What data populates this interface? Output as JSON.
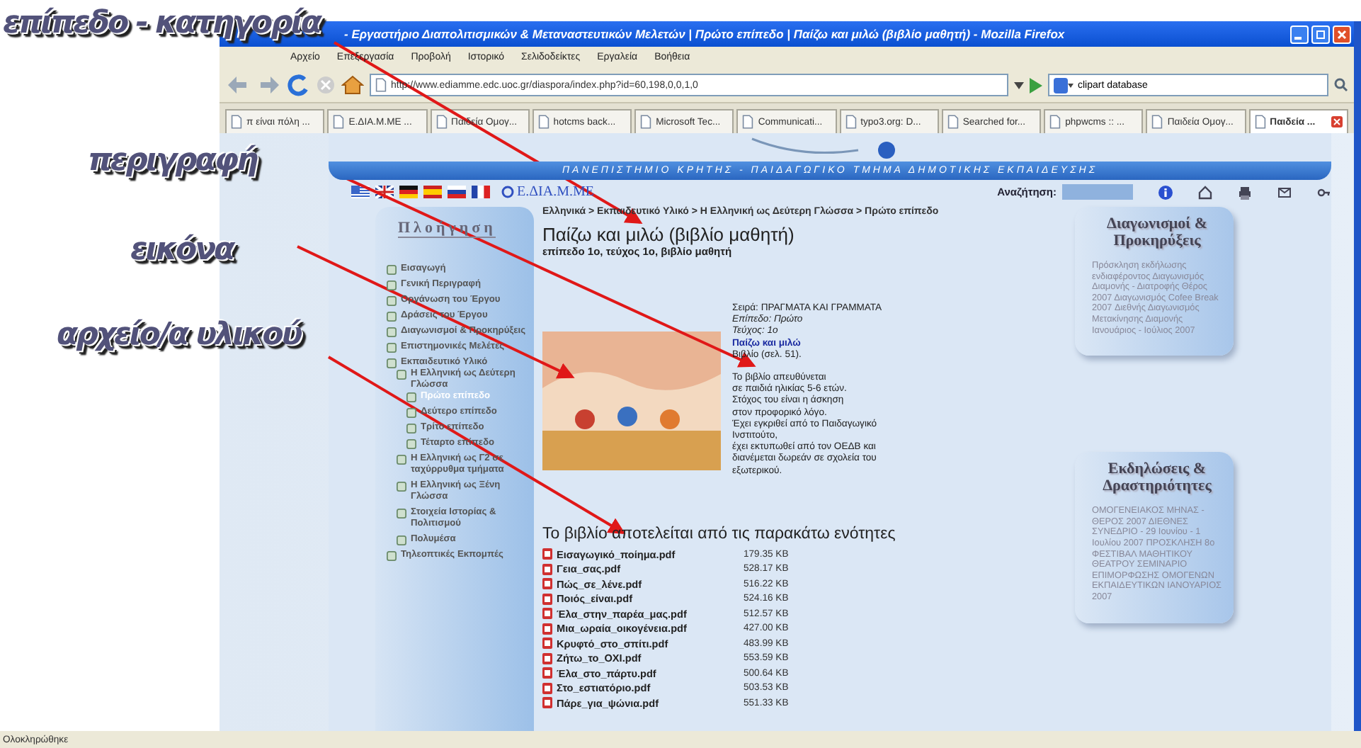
{
  "annotations": [
    {
      "label": "επίπεδο - κατηγορία"
    },
    {
      "label": "περιγραφή"
    },
    {
      "label": "εικόνα"
    },
    {
      "label": "αρχείο/α υλικού"
    }
  ],
  "window": {
    "title": "- Εργαστήριο Διαπολιτισμικών & Μεταναστευτικών Μελετών | Πρώτο επίπεδο | Παίζω και μιλώ (βιβλίο μαθητή) - Mozilla Firefox"
  },
  "menu": [
    "Αρχείο",
    "Επεξεργασία",
    "Προβολή",
    "Ιστορικό",
    "Σελιδοδείκτες",
    "Εργαλεία",
    "Βοήθεια"
  ],
  "toolbar": {
    "url": "http://www.ediamme.edc.uoc.gr/diaspora/index.php?id=60,198,0,0,1,0",
    "search": "clipart database"
  },
  "tabs": [
    {
      "label": "π είναι πόλη ...",
      "selected": false
    },
    {
      "label": "E.ΔΙΑ.Μ.ΜΕ ...",
      "selected": false
    },
    {
      "label": "Παιδεία Ομογ...",
      "selected": false
    },
    {
      "label": "hotcms back...",
      "selected": false
    },
    {
      "label": "Microsoft Tec...",
      "selected": false
    },
    {
      "label": "Communicati...",
      "selected": false
    },
    {
      "label": "typo3.org: D...",
      "selected": false
    },
    {
      "label": "Searched for...",
      "selected": false
    },
    {
      "label": "phpwcms :: ...",
      "selected": false
    },
    {
      "label": "Παιδεία Ομογ...",
      "selected": false
    },
    {
      "label": "Παιδεία ...",
      "selected": true
    }
  ],
  "page": {
    "banner": "ΠΑΝΕΠΙΣΤΗΜΙΟ ΚΡΗΤΗΣ - ΠΑΙΔΑΓΩΓΙΚΟ ΤΜΗΜΑ ΔΗΜΟΤΙΚΗΣ ΕΚΠΑΙΔΕΥΣΗΣ",
    "logo": "E.ΔΙΑ.Μ.ΜΕ",
    "search_label": "Αναζήτηση:",
    "nav": {
      "title": "Πλοήγηση",
      "items": [
        {
          "label": "Εισαγωγή",
          "selected": false
        },
        {
          "label": "Γενική Περιγραφή",
          "selected": false
        },
        {
          "label": "Οργάνωση του Έργου",
          "selected": false
        },
        {
          "label": "Δράσεις του Έργου",
          "selected": false
        },
        {
          "label": "Διαγωνισμοί & Προκηρύξεις",
          "selected": false
        },
        {
          "label": "Επιστημονικές Μελέτες",
          "selected": false
        },
        {
          "label": "Εκπαιδευτικό Υλικό",
          "selected": false,
          "children": [
            {
              "label": "Η Ελληνική ως Δεύτερη Γλώσσα",
              "selected": false,
              "children": [
                {
                  "label": "Πρώτο επίπεδο",
                  "selected": true
                },
                {
                  "label": "Δεύτερο επίπεδο",
                  "selected": false
                },
                {
                  "label": "Τρίτο επίπεδο",
                  "selected": false
                },
                {
                  "label": "Τέταρτο επίπεδο",
                  "selected": false
                }
              ]
            },
            {
              "label": "Η Ελληνική ως Γ2 σε ταχύρρυθμα τμήματα",
              "selected": false
            },
            {
              "label": "Η Ελληνική ως Ξένη Γλώσσα",
              "selected": false
            },
            {
              "label": "Στοιχεία Ιστορίας & Πολιτισμού",
              "selected": false
            },
            {
              "label": "Πολυμέσα",
              "selected": false
            }
          ]
        },
        {
          "label": "Τηλεοπτικές Εκπομπές",
          "selected": false
        }
      ]
    },
    "breadcrumb": "Ελληνικά > Εκπαιδευτικό Υλικό > Η Ελληνική ως Δεύτερη Γλώσσα > Πρώτο επίπεδο",
    "title": "Παίζω και μιλώ (βιβλίο μαθητή)",
    "subtitle": "επίπεδο 1ο, τεύχος 1ο, βιβλίο μαθητή",
    "details": [
      {
        "kind": "plain",
        "text": "Σειρά: ΠΡΑΓΜΑΤΑ ΚΑΙ ΓΡΑΜΜΑΤΑ"
      },
      {
        "kind": "italic",
        "text": "Επίπεδο: Πρώτο"
      },
      {
        "kind": "italic",
        "text": "Τεύχος: 1ο"
      },
      {
        "kind": "link",
        "text": "Παίζω και μιλώ"
      },
      {
        "kind": "plain",
        "text": "Βιβλίο (σελ. 51)."
      }
    ],
    "description": "Το βιβλίο απευθύνεται\nσε παιδιά ηλικίας 5-6 ετών.\nΣτόχος του είναι η άσκηση\nστον προφορικό λόγο.\nΈχει εγκριθεί από το Παιδαγωγικό\nΙνστιτούτο,\nέχει εκτυπωθεί από τον ΟΕΔΒ και\nδιανέμεται δωρεάν σε σχολεία του\nεξωτερικού.",
    "files_heading": "Το βιβλίο αποτελείται από τις παρακάτω ενότητες",
    "files": [
      {
        "name": "Εισαγωγικό_ποίημα.pdf",
        "size": "179.35 KB"
      },
      {
        "name": "Γεια_σας.pdf",
        "size": "528.17 KB"
      },
      {
        "name": "Πώς_σε_λένε.pdf",
        "size": "516.22 KB"
      },
      {
        "name": "Ποιός_είναι.pdf",
        "size": "524.16 KB"
      },
      {
        "name": "Έλα_στην_παρέα_μας.pdf",
        "size": "512.57 KB"
      },
      {
        "name": "Μια_ωραία_οικογένεια.pdf",
        "size": "427.00 KB"
      },
      {
        "name": "Κρυφτό_στο_σπίτι.pdf",
        "size": "483.99 KB"
      },
      {
        "name": "Ζήτω_το_ΟΧΙ.pdf",
        "size": "553.59 KB"
      },
      {
        "name": "Έλα_στο_πάρτυ.pdf",
        "size": "500.64 KB"
      },
      {
        "name": "Στο_εστιατόριο.pdf",
        "size": "503.53 KB"
      },
      {
        "name": "Πάρε_για_ψώνια.pdf",
        "size": "551.33 KB"
      }
    ],
    "side_boxes": [
      {
        "title": "Διαγωνισμοί & Προκηρύξεις",
        "text": "Πρόσκληση εκδήλωσης ενδιαφέροντος Διαγωνισμός Διαμονής - Διατροφής Θέρος 2007 Διαγωνισμός Cofee Break 2007 Διεθνής Διαγωνισμός Μετακίνησης Διαμονής Ιανουάριος - Ιούλιος 2007"
      },
      {
        "title": "Εκδηλώσεις & Δραστηριότητες",
        "text": "ΟΜΟΓΕΝΕΙΑΚΟΣ ΜΗΝΑΣ - ΘΕΡΟΣ 2007 ΔΙΕΘΝΕΣ ΣΥΝΕΔΡΙΟ - 29 Ιουνίου - 1 Ιουλίου 2007 ΠΡΟΣΚΛΗΣΗ 8ο ΦΕΣΤΙΒΑΛ ΜΑΘΗΤΙΚΟΥ ΘΕΑΤΡΟΥ ΣΕΜΙΝΑΡΙΟ ΕΠΙΜΟΡΦΩΣΗΣ ΟΜΟΓΕΝΩΝ ΕΚΠΑΙΔΕΥΤΙΚΩΝ ΙΑΝΟΥΑΡΙΟΣ 2007"
      }
    ]
  },
  "status_bar": "Ολοκληρώθηκε"
}
